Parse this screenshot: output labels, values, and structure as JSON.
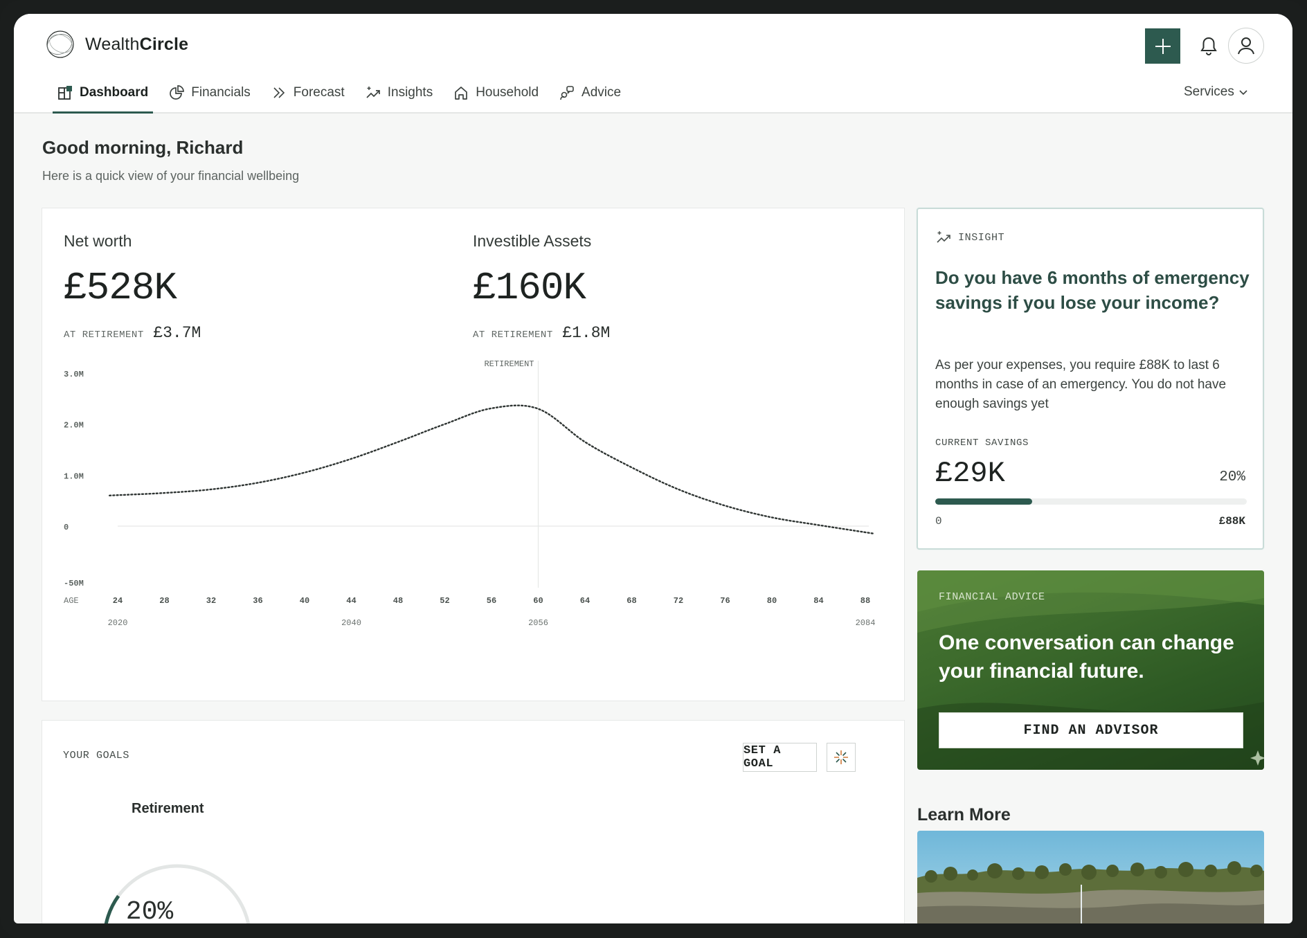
{
  "app": {
    "brand_light": "Wealth",
    "brand_bold": "Circle"
  },
  "nav": {
    "items": [
      {
        "label": "Dashboard",
        "icon": "dashboard-icon"
      },
      {
        "label": "Financials",
        "icon": "pie-chart-icon"
      },
      {
        "label": "Forecast",
        "icon": "double-chevron-right-icon"
      },
      {
        "label": "Insights",
        "icon": "sparkle-trend-icon"
      },
      {
        "label": "Household",
        "icon": "home-icon"
      },
      {
        "label": "Advice",
        "icon": "advice-icon"
      }
    ],
    "services": "Services"
  },
  "greeting": {
    "title": "Good morning, Richard",
    "subtitle": "Here is a quick view of your financial wellbeing"
  },
  "net_worth": {
    "label": "Net worth",
    "value": "£528K",
    "ret_label": "AT RETIREMENT",
    "ret_value": "£3.7M"
  },
  "investible": {
    "label": "Investible Assets",
    "value": "£160K",
    "ret_label": "AT RETIREMENT",
    "ret_value": "£1.8M"
  },
  "chart_data": {
    "type": "line",
    "retirement_label": "RETIREMENT",
    "retirement_age": 60,
    "age_label": "AGE",
    "y_ticks": [
      {
        "value": 3000000,
        "label": "3.0M"
      },
      {
        "value": 2000000,
        "label": "2.0M"
      },
      {
        "value": 1000000,
        "label": "1.0M"
      },
      {
        "value": 0,
        "label": "0"
      },
      {
        "value": -1100000,
        "label": "-50M"
      }
    ],
    "ylim": [
      -1100000,
      3000000
    ],
    "xlim": [
      24,
      88
    ],
    "x_ticks": [
      24,
      28,
      32,
      36,
      40,
      44,
      48,
      52,
      56,
      60,
      64,
      68,
      72,
      76,
      80,
      84,
      88
    ],
    "year_ticks": [
      {
        "age": 24,
        "label": "2020"
      },
      {
        "age": 44,
        "label": "2040"
      },
      {
        "age": 60,
        "label": "2056"
      },
      {
        "age": 88,
        "label": "2084"
      }
    ],
    "series": [
      {
        "x": [
          23.3,
          28,
          32,
          36,
          40,
          44,
          48,
          52,
          56,
          60,
          64,
          68,
          72,
          76,
          80,
          84,
          88.8
        ],
        "y": [
          600000,
          650000,
          720000,
          850000,
          1050000,
          1320000,
          1650000,
          2000000,
          2310000,
          2300000,
          1650000,
          1150000,
          720000,
          400000,
          170000,
          20000,
          -150000
        ]
      }
    ]
  },
  "goals": {
    "title": "YOUR GOALS",
    "set_goal": "SET A GOAL",
    "retirement_label": "Retirement",
    "retirement_progress": 0.2,
    "retirement_pct": "20%"
  },
  "insight": {
    "tag": "INSIGHT",
    "question": "Do you have 6 months of emergency savings if you lose your income?",
    "body": "As per your expenses, you require £88K to last 6 months in case of an emergency. You do not have enough savings yet",
    "savings_label": "CURRENT SAVINGS",
    "savings_value": "£29K",
    "savings_pct": "20%",
    "progress": 0.31,
    "min": "0",
    "max": "£88K"
  },
  "advice": {
    "tag": "FINANCIAL ADVICE",
    "title": "One conversation can change your financial future.",
    "button": "FIND AN ADVISOR"
  },
  "learn_more": {
    "title": "Learn More"
  },
  "colors": {
    "accent": "#2d5a4f",
    "background": "#f6f7f6",
    "advice_green": "#3c6a2c"
  }
}
